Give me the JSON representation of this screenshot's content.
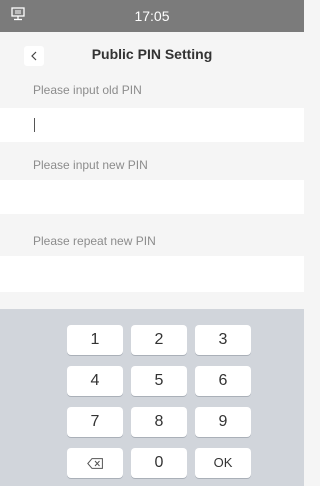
{
  "status_bar": {
    "time": "17:05",
    "network_icon": "network-icon",
    "background_color": "#7b7b7b"
  },
  "header": {
    "title": "Public PIN Setting",
    "back_icon": "chevron-left-icon"
  },
  "fields": {
    "old_pin_label": "Please input old PIN",
    "new_pin_label": "Please input new PIN",
    "repeat_pin_label": "Please repeat new PIN"
  },
  "keypad": {
    "keys": [
      "1",
      "2",
      "3",
      "4",
      "5",
      "6",
      "7",
      "8",
      "9",
      "",
      "0",
      "OK"
    ],
    "backspace_icon": "backspace-icon"
  }
}
